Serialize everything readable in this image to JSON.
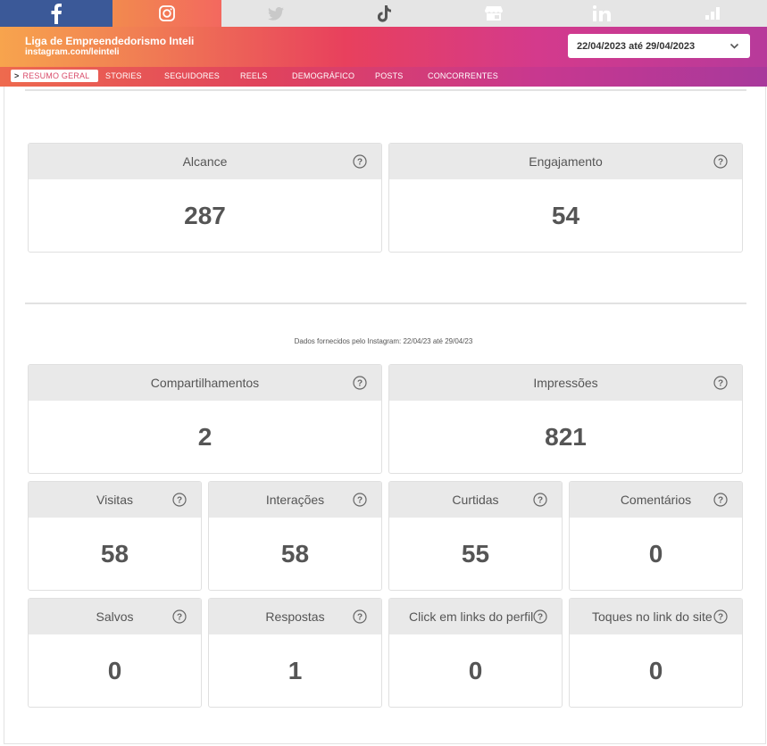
{
  "networks": [
    {
      "name": "facebook",
      "icon": "facebook-icon"
    },
    {
      "name": "instagram",
      "icon": "instagram-icon"
    },
    {
      "name": "twitter",
      "icon": "twitter-icon"
    },
    {
      "name": "tiktok",
      "icon": "tiktok-icon"
    },
    {
      "name": "google-business",
      "icon": "store-icon"
    },
    {
      "name": "linkedin",
      "icon": "linkedin-icon"
    },
    {
      "name": "analytics",
      "icon": "bar-chart-icon"
    }
  ],
  "account": {
    "name": "Liga de Empreendedorismo Inteli",
    "url": "instagram.com/leinteli"
  },
  "date_range": "22/04/2023 até 29/04/2023",
  "tabs": [
    "RESUMO GERAL",
    "STORIES",
    "SEGUIDORES",
    "REELS",
    "DEMOGRÁFICO",
    "POSTS",
    "CONCORRENTES"
  ],
  "active_tab": "RESUMO GERAL",
  "caption": "Dados fornecidos pelo Instagram: 22/04/23 até 29/04/23",
  "metrics": {
    "alcance": {
      "label": "Alcance",
      "value": "287"
    },
    "engajamento": {
      "label": "Engajamento",
      "value": "54"
    },
    "compartilhamentos": {
      "label": "Compartilhamentos",
      "value": "2"
    },
    "impressoes": {
      "label": "Impressões",
      "value": "821"
    },
    "visitas": {
      "label": "Visitas",
      "value": "58"
    },
    "interacoes": {
      "label": "Interações",
      "value": "58"
    },
    "curtidas": {
      "label": "Curtidas",
      "value": "55"
    },
    "comentarios": {
      "label": "Comentários",
      "value": "0"
    },
    "salvos": {
      "label": "Salvos",
      "value": "0"
    },
    "respostas": {
      "label": "Respostas",
      "value": "1"
    },
    "clicks_links": {
      "label": "Click em links do perfil",
      "value": "0"
    },
    "toques_link": {
      "label": "Toques no link do site",
      "value": "0"
    }
  },
  "colors": {
    "facebook": "#3b5998",
    "inactive_net": "#e5e5e5",
    "card_header": "#e9e9e9",
    "value_text": "#555555"
  }
}
